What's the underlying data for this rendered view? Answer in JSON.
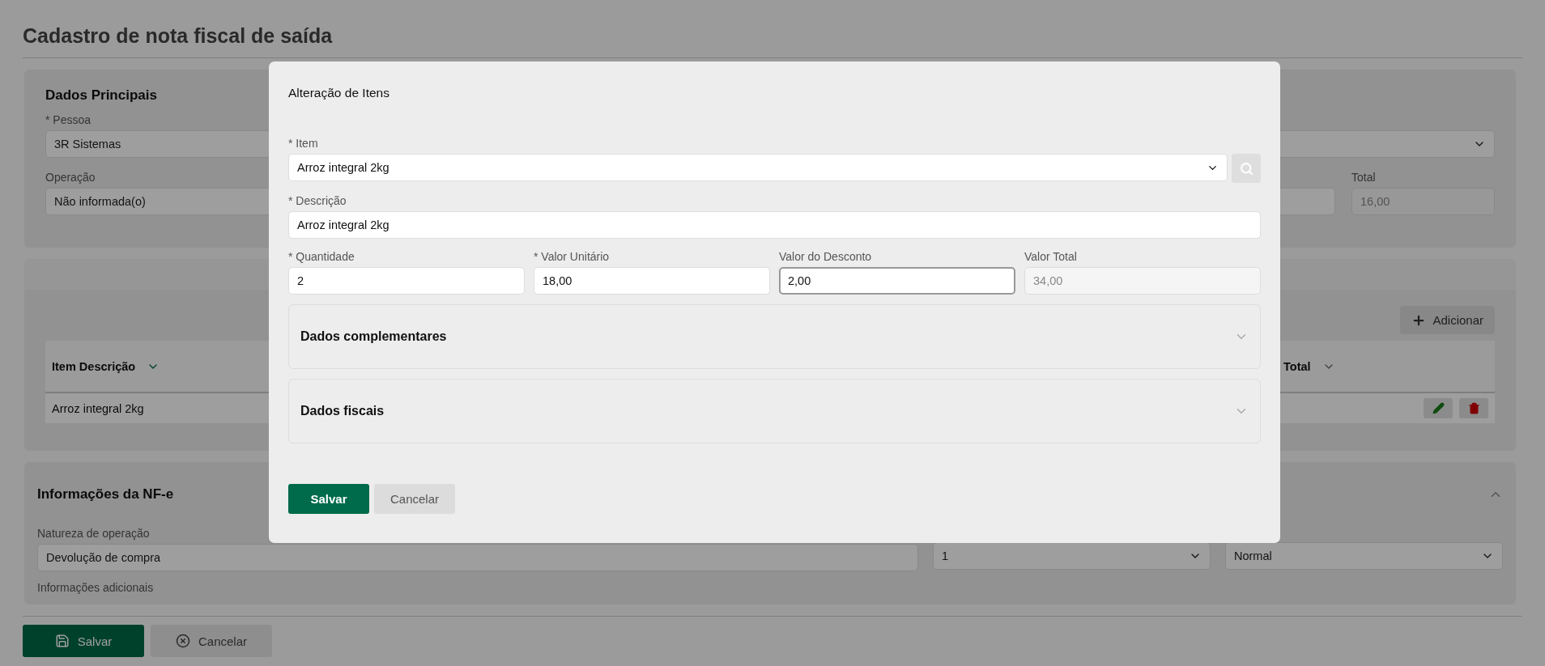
{
  "page": {
    "title": "Cadastro de nota fiscal de saída"
  },
  "main_data": {
    "title": "Dados Principais",
    "pessoa": {
      "label": "* Pessoa",
      "value": "3R Sistemas"
    },
    "operacao": {
      "label": "Operação",
      "value": "Não informada(o)"
    },
    "total": {
      "label": "Total",
      "value": "16,00"
    }
  },
  "items": {
    "add_button": "Adicionar",
    "columns": [
      "Item Descrição",
      "Total"
    ],
    "rows": [
      {
        "description": "Arroz integral 2kg"
      }
    ]
  },
  "nfe": {
    "title": "Informações da NF-e",
    "expanded": true,
    "natureza": {
      "label": "Natureza de operação",
      "value": "Devolução de compra"
    },
    "serie": {
      "value": "1"
    },
    "finalidade": {
      "value": "Normal"
    },
    "info_label": "Informações adicionais"
  },
  "footer": {
    "buttons": [
      {
        "label": "Salvar",
        "kind": "primary"
      },
      {
        "label": "Cancelar",
        "kind": "secondary"
      }
    ]
  },
  "modal": {
    "title": "Alteração de Itens",
    "item": {
      "label": "* Item",
      "value": "Arroz integral 2kg"
    },
    "descricao": {
      "label": "* Descrição",
      "value": "Arroz integral 2kg"
    },
    "fields": [
      {
        "label": "* Quantidade",
        "value": "2",
        "focused": false,
        "disabled": false
      },
      {
        "label": "* Valor Unitário",
        "value": "18,00",
        "focused": false,
        "disabled": false
      },
      {
        "label": "Valor do Desconto",
        "value": "2,00",
        "focused": true,
        "disabled": false
      },
      {
        "label": "Valor Total",
        "value": "34,00",
        "focused": false,
        "disabled": true
      }
    ],
    "sections": [
      {
        "title": "Dados complementares",
        "expanded": false
      },
      {
        "title": "Dados fiscais",
        "expanded": false
      }
    ],
    "buttons": [
      {
        "label": "Salvar",
        "kind": "primary"
      },
      {
        "label": "Cancelar",
        "kind": "secondary"
      }
    ]
  }
}
